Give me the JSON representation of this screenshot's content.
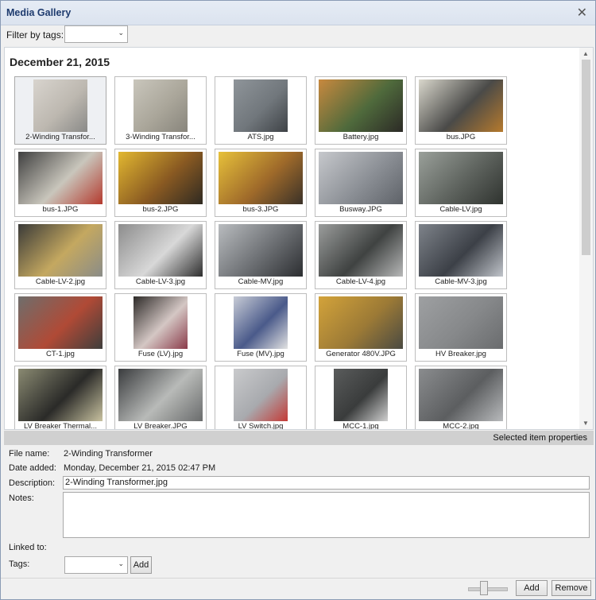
{
  "window": {
    "title": "Media Gallery",
    "close_glyph": "✕"
  },
  "filter": {
    "label": "Filter by tags:",
    "value": ""
  },
  "gallery": {
    "date_header": "December 21, 2015",
    "items": [
      {
        "caption": "2-Winding Transfor...",
        "colors": [
          "#d8d4ce",
          "#bdb8b0",
          "#8a8a88"
        ],
        "selected": true
      },
      {
        "caption": "3-Winding Transfor...",
        "colors": [
          "#c9c6bc",
          "#aaa69a",
          "#88857c"
        ],
        "selected": false
      },
      {
        "caption": "ATS.jpg",
        "colors": [
          "#8f959a",
          "#71777c",
          "#3e4246"
        ],
        "selected": false
      },
      {
        "caption": "Battery.jpg",
        "colors": [
          "#c8893e",
          "#4f6a3c",
          "#2c2a26"
        ],
        "selected": false
      },
      {
        "caption": "bus.JPG",
        "colors": [
          "#d9d7cc",
          "#4a4a48",
          "#b67a2d"
        ],
        "selected": false
      },
      {
        "caption": "bus-1.JPG",
        "colors": [
          "#3f3f3f",
          "#c9c6bc",
          "#b43a2e"
        ],
        "selected": false
      },
      {
        "caption": "bus-2.JPG",
        "colors": [
          "#e2b830",
          "#8a5a22",
          "#2f2a22"
        ],
        "selected": false
      },
      {
        "caption": "bus-3.JPG",
        "colors": [
          "#e7c13a",
          "#9f6a2a",
          "#3a3128"
        ],
        "selected": false
      },
      {
        "caption": "Busway.JPG",
        "colors": [
          "#c6c8cc",
          "#8c9096",
          "#5e6268"
        ],
        "selected": false
      },
      {
        "caption": "Cable-LV.jpg",
        "colors": [
          "#9aa09a",
          "#5d625d",
          "#2f332f"
        ],
        "selected": false
      },
      {
        "caption": "Cable-LV-2.jpg",
        "colors": [
          "#3a3a38",
          "#c4a860",
          "#8a8c88"
        ],
        "selected": false
      },
      {
        "caption": "Cable-LV-3.jpg",
        "colors": [
          "#8c8c8c",
          "#d8d8d8",
          "#2e2e2e"
        ],
        "selected": false
      },
      {
        "caption": "Cable-MV.jpg",
        "colors": [
          "#b9bcbf",
          "#6b6e72",
          "#2c2e31"
        ],
        "selected": false
      },
      {
        "caption": "Cable-LV-4.jpg",
        "colors": [
          "#9b9d9c",
          "#3f4241",
          "#b7b8b8"
        ],
        "selected": false
      },
      {
        "caption": "Cable-MV-3.jpg",
        "colors": [
          "#7e838a",
          "#3c4047",
          "#c0c4ca"
        ],
        "selected": false
      },
      {
        "caption": "CT-1.jpg",
        "colors": [
          "#6e6e6c",
          "#b04a36",
          "#3e3e3c"
        ],
        "selected": false
      },
      {
        "caption": "Fuse (LV).jpg",
        "colors": [
          "#2d2a28",
          "#d4c7c4",
          "#8a3b4a"
        ],
        "selected": false
      },
      {
        "caption": "Fuse (MV).jpg",
        "colors": [
          "#c8ccd6",
          "#4a5a8a",
          "#e2e2e2"
        ],
        "selected": false
      },
      {
        "caption": "Generator 480V.JPG",
        "colors": [
          "#d3a33a",
          "#9c7a36",
          "#4a4a42"
        ],
        "selected": false
      },
      {
        "caption": "HV Breaker.jpg",
        "colors": [
          "#9ea0a2",
          "#86888a",
          "#6a6c6e"
        ],
        "selected": false
      },
      {
        "caption": "LV Breaker Thermal...",
        "colors": [
          "#8a8a72",
          "#2a2a28",
          "#c8c2a0"
        ],
        "selected": false
      },
      {
        "caption": "LV Breaker.JPG",
        "colors": [
          "#3a3c3e",
          "#b8bab8",
          "#6a6c6c"
        ],
        "selected": false
      },
      {
        "caption": "LV Switch.jpg",
        "colors": [
          "#c9cacc",
          "#a8aaae",
          "#c43a36"
        ],
        "selected": false
      },
      {
        "caption": "MCC-1.jpg",
        "colors": [
          "#5a5c5c",
          "#3a3c3c",
          "#d0d0d0"
        ],
        "selected": false
      },
      {
        "caption": "MCC-2.jpg",
        "colors": [
          "#8a8c8e",
          "#5c5e60",
          "#b8babc"
        ],
        "selected": false
      }
    ]
  },
  "properties": {
    "header": "Selected item properties",
    "file_name_label": "File name:",
    "file_name_value": "2-Winding Transformer",
    "date_added_label": "Date added:",
    "date_added_value": "Monday, December 21, 2015 02:47 PM",
    "description_label": "Description:",
    "description_value": "2-Winding Transformer.jpg",
    "notes_label": "Notes:",
    "notes_value": "",
    "linked_to_label": "Linked to:",
    "tags_label": "Tags:",
    "tags_value": "",
    "tags_add_label": "Add"
  },
  "footer": {
    "add_label": "Add",
    "remove_label": "Remove",
    "zoom_level": 0.4
  }
}
